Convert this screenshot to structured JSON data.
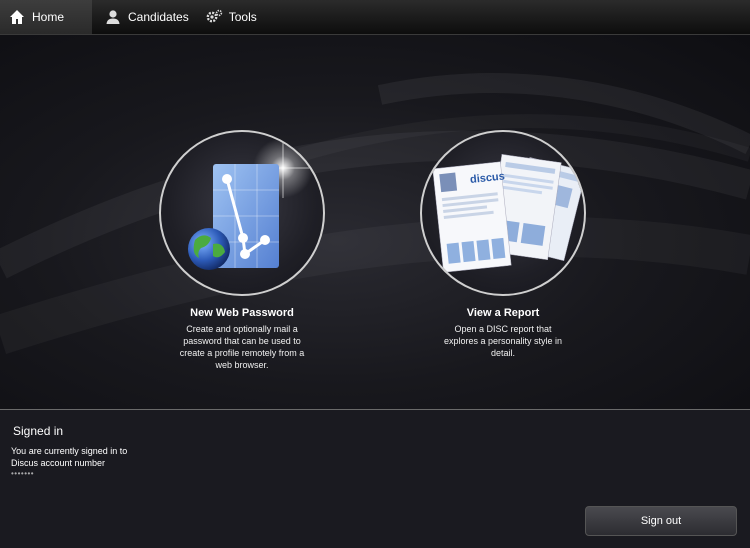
{
  "nav": {
    "home_label": "Home",
    "candidates_label": "Candidates",
    "tools_label": "Tools"
  },
  "tiles": {
    "web_password": {
      "title": "New Web Password",
      "description": "Create and optionally mail a password that can be used to create a profile remotely from a web browser."
    },
    "view_report": {
      "title": "View a Report",
      "description": "Open a DISC report that explores a personality style in detail.",
      "report_logo_text": "discus"
    }
  },
  "signed_in": {
    "title": "Signed in",
    "line1": "You are currently signed in to",
    "line2": "Discus account number",
    "account_number": "•••••••"
  },
  "signout_label": "Sign out",
  "colors": {
    "accent_blue": "#5b8fd8",
    "circle_border": "#cfcfcf"
  }
}
